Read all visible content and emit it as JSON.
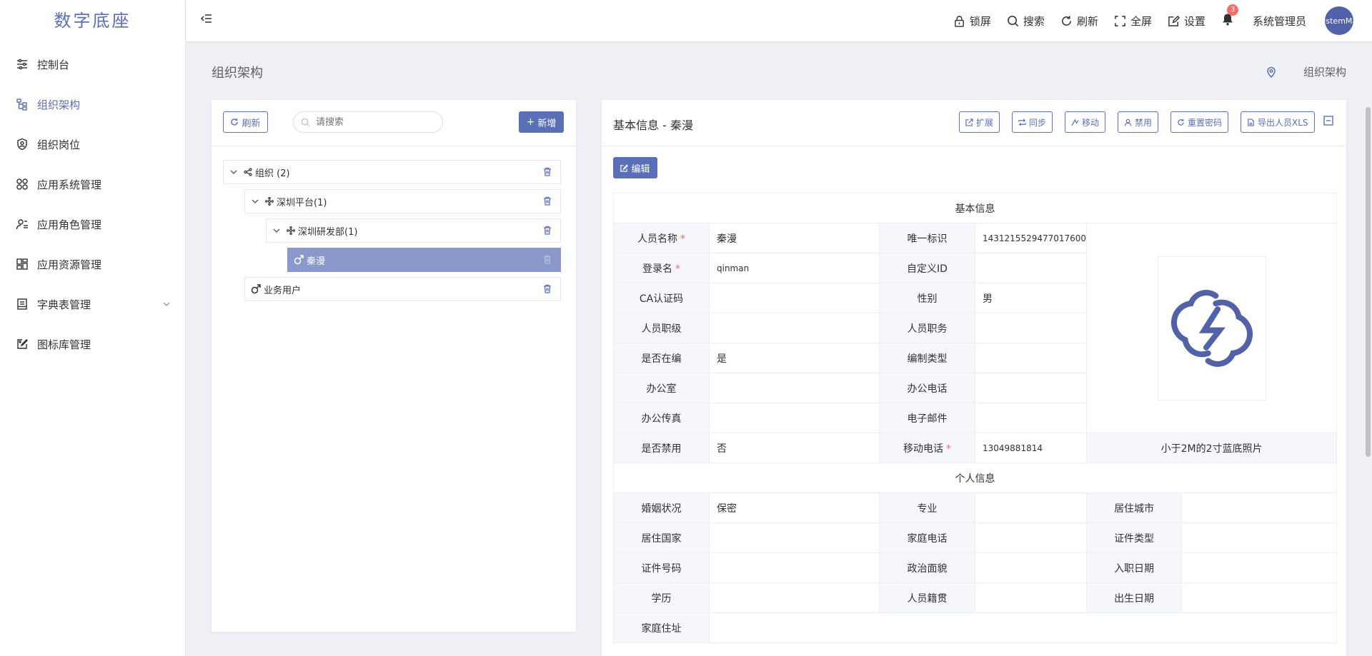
{
  "app": {
    "title": "数字底座"
  },
  "sidebar": {
    "items": [
      {
        "label": "控制台",
        "icon": "sliders-icon"
      },
      {
        "label": "组织架构",
        "icon": "org-tree-icon"
      },
      {
        "label": "组织岗位",
        "icon": "shield-user-icon"
      },
      {
        "label": "应用系统管理",
        "icon": "grid-icon"
      },
      {
        "label": "应用角色管理",
        "icon": "user-list-icon"
      },
      {
        "label": "应用资源管理",
        "icon": "dashboard-icon"
      },
      {
        "label": "字典表管理",
        "icon": "book-icon"
      },
      {
        "label": "图标库管理",
        "icon": "image-edit-icon"
      }
    ]
  },
  "header": {
    "tools": {
      "lock": "锁屏",
      "search": "搜索",
      "refresh": "刷新",
      "fullscreen": "全屏",
      "settings": "设置"
    },
    "notification_count": "3",
    "user_name": "系统管理员",
    "avatar_text": "SystemMan"
  },
  "page": {
    "title": "组织架构",
    "breadcrumb": "组织架构"
  },
  "left_panel": {
    "refresh_label": "刷新",
    "search_placeholder": "请搜索",
    "add_label": "新增",
    "tree": [
      {
        "label": "组织 (2)"
      },
      {
        "label": "深圳平台(1)"
      },
      {
        "label": "深圳研发部(1)"
      },
      {
        "label": "秦漫"
      },
      {
        "label": "业务用户"
      }
    ]
  },
  "right_panel": {
    "title": "基本信息 - 秦漫",
    "actions": {
      "expand": "扩展",
      "sync": "同步",
      "move": "移动",
      "disable": "禁用",
      "reset_password": "重置密码",
      "export": "导出人员XLS"
    },
    "edit_label": "编辑",
    "basic_section": "基本信息",
    "personal_section": "个人信息",
    "basic": {
      "name_label": "人员名称",
      "name": "秦漫",
      "uid_label": "唯一标识",
      "uid": "1431215529477017600",
      "login_label": "登录名",
      "login": "qinman",
      "custom_id_label": "自定义ID",
      "custom_id": "",
      "ca_label": "CA认证码",
      "ca": "",
      "gender_label": "性别",
      "gender": "男",
      "level_label": "人员职级",
      "level": "",
      "duty_label": "人员职务",
      "duty": "",
      "staffed_label": "是否在编",
      "staffed": "是",
      "staff_type_label": "编制类型",
      "staff_type": "",
      "office_label": "办公室",
      "office": "",
      "office_phone_label": "办公电话",
      "office_phone": "",
      "fax_label": "办公传真",
      "fax": "",
      "email_label": "电子邮件",
      "email": "",
      "disabled_label": "是否禁用",
      "disabled": "否",
      "mobile_label": "移动电话",
      "mobile": "13049881814",
      "photo_hint": "小于2M的2寸蓝底照片"
    },
    "personal": {
      "marital_label": "婚姻状况",
      "marital": "保密",
      "major_label": "专业",
      "major": "",
      "city_label": "居住城市",
      "city": "",
      "country_label": "居住国家",
      "country": "",
      "home_phone_label": "家庭电话",
      "home_phone": "",
      "id_type_label": "证件类型",
      "id_type": "",
      "id_no_label": "证件号码",
      "id_no": "",
      "political_label": "政治面貌",
      "political": "",
      "hire_date_label": "入职日期",
      "hire_date": "",
      "education_label": "学历",
      "education": "",
      "native_label": "人员籍贯",
      "native": "",
      "birth_label": "出生日期",
      "birth": "",
      "address_label": "家庭住址",
      "address": ""
    }
  },
  "colors": {
    "primary": "#5b6fb6",
    "selected_node": "#8b98cc",
    "required": "#f56c6c"
  }
}
